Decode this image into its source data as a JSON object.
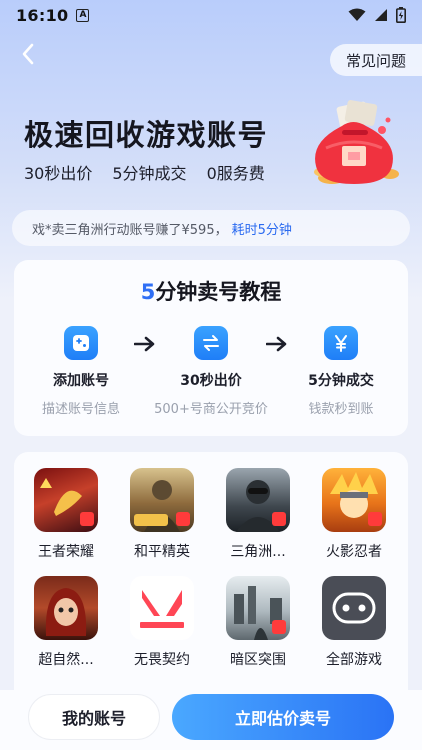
{
  "status_bar": {
    "time": "16:10",
    "notif_icon": "A"
  },
  "header": {
    "faq_label": "常见问题"
  },
  "hero": {
    "title": "极速回收游戏账号",
    "features": [
      "30秒出价",
      "5分钟成交",
      "0服务费"
    ]
  },
  "notice": {
    "text": "戏*卖三角洲行动账号赚了¥595，",
    "highlight": "耗时5分钟"
  },
  "tutorial": {
    "title_num": "5",
    "title_rest": "分钟卖号教程",
    "steps": [
      {
        "title": "添加账号",
        "desc": "描述账号信息",
        "icon": "gamepad-icon"
      },
      {
        "title": "30秒出价",
        "desc": "500+号商公开竞价",
        "icon": "exchange-icon"
      },
      {
        "title": "5分钟成交",
        "desc": "钱款秒到账",
        "icon": "yuan-icon"
      }
    ]
  },
  "games": [
    {
      "name": "王者荣耀"
    },
    {
      "name": "和平精英"
    },
    {
      "name": "三角洲..."
    },
    {
      "name": "火影忍者"
    },
    {
      "name": "超自然..."
    },
    {
      "name": "无畏契约"
    },
    {
      "name": "暗区突围"
    },
    {
      "name": "全部游戏"
    }
  ],
  "bottom": {
    "my_account": "我的账号",
    "sell": "立即估价卖号"
  },
  "colors": {
    "accent": "#2f6ff5",
    "button_start": "#4aa8ff",
    "button_end": "#2a73f5"
  }
}
